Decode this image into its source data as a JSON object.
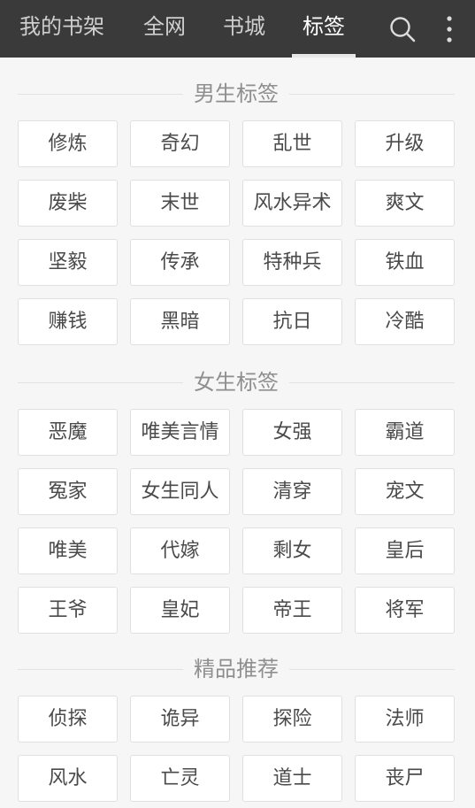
{
  "nav": {
    "tabs": [
      {
        "label": "我的书架"
      },
      {
        "label": "全网"
      },
      {
        "label": "书城"
      },
      {
        "label": "标签"
      }
    ],
    "active_tab": "标签",
    "search_icon": "search-icon",
    "more_icon": "more-vertical-icon"
  },
  "sections": [
    {
      "title": "男生标签",
      "tags": [
        "修炼",
        "奇幻",
        "乱世",
        "升级",
        "废柴",
        "末世",
        "风水异术",
        "爽文",
        "坚毅",
        "传承",
        "特种兵",
        "铁血",
        "赚钱",
        "黑暗",
        "抗日",
        "冷酷"
      ]
    },
    {
      "title": "女生标签",
      "tags": [
        "恶魔",
        "唯美言情",
        "女强",
        "霸道",
        "冤家",
        "女生同人",
        "清穿",
        "宠文",
        "唯美",
        "代嫁",
        "剩女",
        "皇后",
        "王爷",
        "皇妃",
        "帝王",
        "将军"
      ]
    },
    {
      "title": "精品推荐",
      "tags": [
        "侦探",
        "诡异",
        "探险",
        "法师",
        "风水",
        "亡灵",
        "道士",
        "丧尸"
      ]
    }
  ],
  "colors": {
    "topbar_bg": "#3a3a3a",
    "active_tab": "#ffffff",
    "inactive_tab": "#cfcfcf",
    "page_bg": "#f6f6f6",
    "tag_text": "#4a4a4a",
    "section_title": "#8f8f8f"
  }
}
